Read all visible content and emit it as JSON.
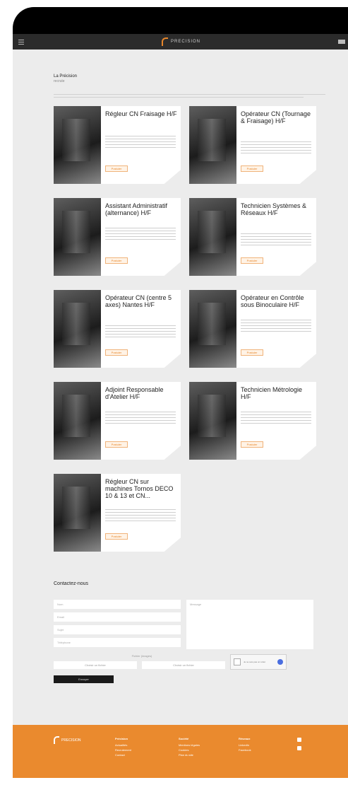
{
  "navbar": {
    "logo_text": "PRECISION"
  },
  "section": {
    "title": "La Précision",
    "subtitle": "recrute"
  },
  "jobs": [
    {
      "title": "Régleur CN Fraisage H/F",
      "cta": "Postuler"
    },
    {
      "title": "Opérateur CN (Tournage & Fraisage) H/F",
      "cta": "Postuler"
    },
    {
      "title": "Assistant Administratif (alternance) H/F",
      "cta": "Postuler"
    },
    {
      "title": "Technicien Systèmes & Réseaux H/F",
      "cta": "Postuler"
    },
    {
      "title": "Opérateur CN (centre 5 axes) Nantes H/F",
      "cta": "Postuler"
    },
    {
      "title": "Opérateur en Contrôle sous Binoculaire H/F",
      "cta": "Postuler"
    },
    {
      "title": "Adjoint Responsable d'Atelier H/F",
      "cta": "Postuler"
    },
    {
      "title": "Technicien Métrologie H/F",
      "cta": "Postuler"
    },
    {
      "title": "Régleur CN sur machines Tornos DECO 10 & 13 et CN...",
      "cta": "Postuler"
    }
  ],
  "contact": {
    "title": "Contactez-nous",
    "fields": [
      "Nom",
      "Email",
      "Sujet",
      "Téléphone"
    ],
    "message_placeholder": "Message",
    "file_label": "Fichier (images)",
    "file_button_1": "Choisir un fichier",
    "file_button_2": "Choisir un fichier",
    "captcha_text": "Je ne suis pas un robot",
    "submit": "Envoyer"
  },
  "footer": {
    "logo_text": "PRECISION",
    "columns": [
      {
        "title": "Précision",
        "items": [
          "Actualités",
          "Recrutement",
          "Contact"
        ]
      },
      {
        "title": "Société",
        "items": [
          "Mentions légales",
          "Cookies",
          "Plan du site"
        ]
      },
      {
        "title": "Réseaux",
        "items": [
          "LinkedIn",
          "Facebook"
        ]
      }
    ]
  }
}
